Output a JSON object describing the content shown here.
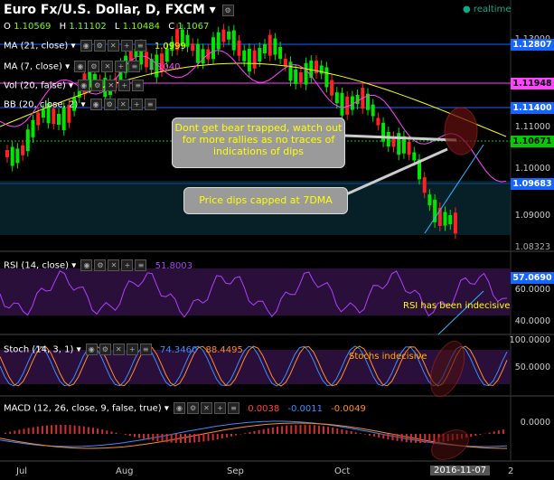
{
  "header": {
    "symbol": "Euro Fx/U.S. Dollar, D, FXCM",
    "status": "realtime",
    "ohlc": {
      "o_label": "O",
      "o": "1.10569",
      "h_label": "H",
      "h": "1.11102",
      "l_label": "L",
      "l": "1.10484",
      "c_label": "C",
      "c": "1.1067"
    }
  },
  "overlays": [
    {
      "label": "MA (21, close)",
      "value": "1.0999",
      "color": "#ffff00"
    },
    {
      "label": "MA (7, close)",
      "value": "1.1040",
      "color": "#ff44ff"
    },
    {
      "label": "Vol (20, false)",
      "value": ""
    },
    {
      "label": "BB (20, close, 2)",
      "value": ""
    }
  ],
  "price_axis": {
    "ticks": [
      "1.13000",
      "1.12807",
      "1.11948",
      "1.11400",
      "1.11000",
      "1.10671",
      "1.10000",
      "1.09683",
      "1.09000",
      "1.08323"
    ],
    "highlight_1": "1.12807",
    "highlight_2": "1.11948",
    "highlight_3": "1.11400",
    "highlight_4": "1.10671",
    "highlight_5": "1.09683",
    "highlight_6": "1.08323"
  },
  "notes": {
    "note1": "Dont get bear trapped, watch out for more rallies as no traces of indications of dips",
    "note2": "Price dips capped at 7DMA",
    "rsi_note": "RSI has been indecisive",
    "stoch_note": "Stochs indecisive"
  },
  "rsi": {
    "label": "RSI (14, close)",
    "value": "51.8003",
    "tag": "57.0690",
    "ticks": [
      "60.0000",
      "40.0000"
    ]
  },
  "stoch": {
    "label": "Stoch (14, 3, 1)",
    "k": "74.3460",
    "d": "88.4495",
    "ticks": [
      "100.0000",
      "50.0000"
    ]
  },
  "macd": {
    "label": "MACD (12, 26, close, 9, false, true)",
    "v1": "0.0038",
    "v2": "-0.0011",
    "v3": "-0.0049",
    "ticks": [
      "0.0000"
    ]
  },
  "time_axis": {
    "labels": [
      "Jul",
      "Aug",
      "Sep",
      "Oct",
      "2016-11-07",
      "2"
    ]
  },
  "colors": {
    "up": "#00e600",
    "down": "#ff2222",
    "ma21": "#ffff00",
    "ma7": "#ff44ff",
    "bb": "#1e90ff",
    "tag_blue": "#1565ff",
    "tag_pink": "#ff44ff",
    "tag_green": "#00cc00"
  }
}
